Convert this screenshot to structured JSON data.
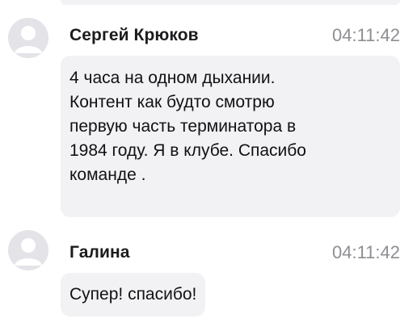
{
  "messages": [
    {
      "author": "Сергей Крюков",
      "time": "04:11:42",
      "text": "4 часа на одном дыхании.\nКонтент как будто смотрю\nпервую часть терминатора в\n1984 году. Я в клубе. Спасибо\nкоманде .",
      "avatar_icon": "default-user-avatar-icon"
    },
    {
      "author": "Галина",
      "time": "04:11:42",
      "text": "Супер! спасибо!",
      "avatar_icon": "default-user-avatar-icon"
    }
  ],
  "colors": {
    "bubble_background": "#f2f2f5",
    "avatar_background": "#e3e3e8",
    "avatar_glyph": "#ffffff",
    "timestamp": "#8e8e93",
    "author_text": "#1c1c1e",
    "message_text": "#111111"
  }
}
